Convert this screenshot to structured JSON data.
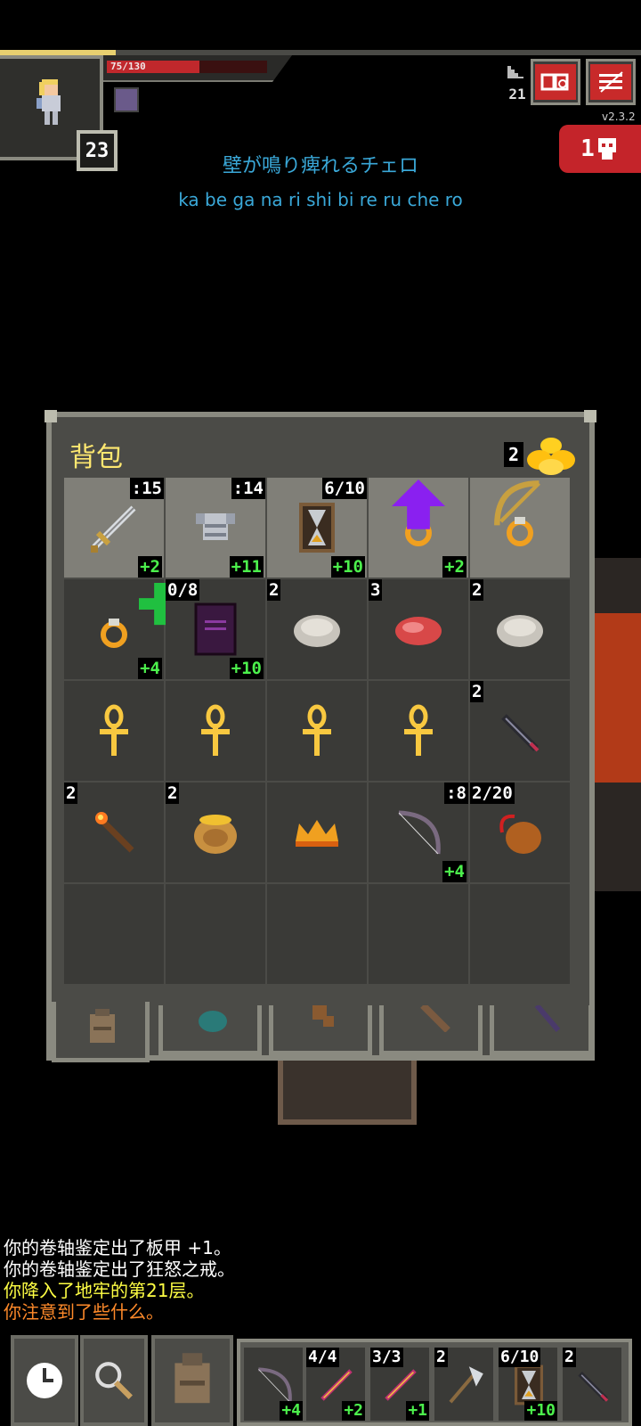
{
  "hud": {
    "hp_text": "75/130",
    "hp_fraction": 0.577,
    "level": "23",
    "depth": "21",
    "version": "v2.3.2",
    "danger_count": "1",
    "journal_icon": "journal-icon",
    "menu_icon": "menu-icon"
  },
  "song": {
    "japanese": "壁が鳴り痺れるチェロ",
    "romaji": "ka be ga na ri shi bi re ru che ro"
  },
  "inventory": {
    "title": "背包",
    "gold_count": "2",
    "rows": [
      [
        {
          "icon": "sword-icon",
          "qty": ":15",
          "qty_side": "right",
          "bonus": "+2",
          "equipped": true
        },
        {
          "icon": "armor-icon",
          "qty": ":14",
          "qty_side": "right",
          "bonus": "+11",
          "equipped": true
        },
        {
          "icon": "hourglass-icon",
          "qty": "6/10",
          "qty_side": "right",
          "bonus": "+10",
          "equipped": true
        },
        {
          "icon": "ring-icon",
          "qty": "",
          "qty_side": "right",
          "bonus": "+2",
          "equipped": true,
          "mark": "upgrade-arrow-icon"
        },
        {
          "icon": "ring-icon",
          "qty": "",
          "qty_side": "right",
          "bonus": "",
          "equipped": true,
          "mark": "bow-mark-icon"
        }
      ],
      [
        {
          "icon": "ring-icon",
          "qty": "",
          "qty_side": "left",
          "bonus": "+4",
          "equipped": false,
          "mark": "plus-mark-icon"
        },
        {
          "icon": "spellbook-icon",
          "qty": "0/8",
          "qty_side": "left",
          "bonus": "+10",
          "equipped": false
        },
        {
          "icon": "stone-icon",
          "qty": "2",
          "qty_side": "left",
          "bonus": "",
          "equipped": false
        },
        {
          "icon": "meat-icon",
          "qty": "3",
          "qty_side": "left",
          "bonus": "",
          "equipped": false
        },
        {
          "icon": "stone-icon",
          "qty": "2",
          "qty_side": "left",
          "bonus": "",
          "equipped": false
        }
      ],
      [
        {
          "icon": "ankh-icon",
          "qty": "",
          "qty_side": "left",
          "bonus": "",
          "equipped": false
        },
        {
          "icon": "ankh-icon",
          "qty": "",
          "qty_side": "left",
          "bonus": "",
          "equipped": false
        },
        {
          "icon": "ankh-icon",
          "qty": "",
          "qty_side": "left",
          "bonus": "",
          "equipped": false
        },
        {
          "icon": "ankh-icon",
          "qty": "",
          "qty_side": "left",
          "bonus": "",
          "equipped": false
        },
        {
          "icon": "dart-icon",
          "qty": "2",
          "qty_side": "left",
          "bonus": "",
          "equipped": false
        }
      ],
      [
        {
          "icon": "torch-icon",
          "qty": "2",
          "qty_side": "left",
          "bonus": "",
          "equipped": false
        },
        {
          "icon": "honeypot-icon",
          "qty": "2",
          "qty_side": "left",
          "bonus": "",
          "equipped": false
        },
        {
          "icon": "crown-icon",
          "qty": "",
          "qty_side": "left",
          "bonus": "",
          "equipped": false
        },
        {
          "icon": "bow-icon",
          "qty": ":8",
          "qty_side": "right",
          "bonus": "+4",
          "equipped": false
        },
        {
          "icon": "waterskin-icon",
          "qty": "2/20",
          "qty_side": "left",
          "bonus": "",
          "equipped": false
        }
      ],
      [
        {
          "icon": "",
          "qty": "",
          "qty_side": "left",
          "bonus": "",
          "equipped": false
        },
        {
          "icon": "",
          "qty": "",
          "qty_side": "left",
          "bonus": "",
          "equipped": false
        },
        {
          "icon": "",
          "qty": "",
          "qty_side": "left",
          "bonus": "",
          "equipped": false
        },
        {
          "icon": "",
          "qty": "",
          "qty_side": "left",
          "bonus": "",
          "equipped": false
        },
        {
          "icon": "",
          "qty": "",
          "qty_side": "left",
          "bonus": "",
          "equipped": false
        }
      ]
    ],
    "tabs": [
      "backpack-icon",
      "pouch-icon",
      "quiver-icon",
      "holster-icon",
      "wand-holder-icon"
    ]
  },
  "log": [
    {
      "text": "你的卷轴鉴定出了板甲 +1。",
      "color": "#ffffff"
    },
    {
      "text": "你的卷轴鉴定出了狂怒之戒。",
      "color": "#ffffff"
    },
    {
      "text": "你降入了地牢的第21层。",
      "color": "#ffff44"
    },
    {
      "text": "你注意到了些什么。",
      "color": "#ff8a2a"
    }
  ],
  "toolbar": {
    "buttons": [
      "wait-clock-icon",
      "search-magnifier-icon",
      "backpack-icon"
    ],
    "quickslots": [
      {
        "icon": "bow-icon",
        "qty": "",
        "bonus": "+4"
      },
      {
        "icon": "wand-icon",
        "qty": "4/4",
        "bonus": "+2"
      },
      {
        "icon": "wand-icon",
        "qty": "3/3",
        "bonus": "+1"
      },
      {
        "icon": "axe-icon",
        "qty": "2",
        "bonus": ""
      },
      {
        "icon": "hourglass-icon",
        "qty": "6/10",
        "bonus": "+10"
      },
      {
        "icon": "dart-icon",
        "qty": "2",
        "bonus": ""
      }
    ]
  },
  "colors": {
    "gold": "#ffe870",
    "bonus": "#4cf04c",
    "danger": "#c4242a",
    "song": "#3aa8d8"
  }
}
